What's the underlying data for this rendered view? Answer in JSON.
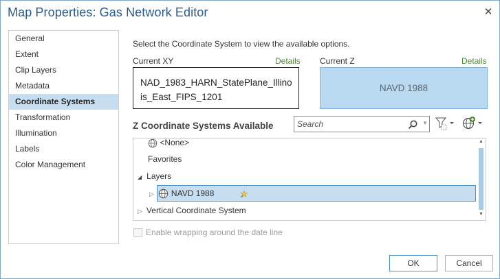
{
  "window": {
    "title": "Map Properties: Gas Network Editor",
    "close_glyph": "✕"
  },
  "sidebar": {
    "items": [
      {
        "label": "General",
        "selected": false
      },
      {
        "label": "Extent",
        "selected": false
      },
      {
        "label": "Clip Layers",
        "selected": false
      },
      {
        "label": "Metadata",
        "selected": false
      },
      {
        "label": "Coordinate Systems",
        "selected": true
      },
      {
        "label": "Transformation",
        "selected": false
      },
      {
        "label": "Illumination",
        "selected": false
      },
      {
        "label": "Labels",
        "selected": false
      },
      {
        "label": "Color Management",
        "selected": false
      }
    ]
  },
  "main": {
    "instruction": "Select the Coordinate System to view the available options.",
    "current_xy": {
      "label": "Current XY",
      "details": "Details",
      "value_line1": "NAD_1983_HARN_StatePlane_Illino",
      "value_line2": "is_East_FIPS_1201"
    },
    "current_z": {
      "label": "Current Z",
      "details": "Details",
      "value": "NAVD 1988"
    },
    "z_section": {
      "title": "Z Coordinate Systems Available",
      "search_placeholder": "Search"
    },
    "tree": {
      "none_item": "<None>",
      "favorites": "Favorites",
      "layers": "Layers",
      "layers_child": "NAVD 1988",
      "vertical": "Vertical Coordinate System"
    },
    "wrap_checkbox": {
      "label": "Enable wrapping around the date line",
      "checked": false,
      "enabled": false
    }
  },
  "footer": {
    "ok": "OK",
    "cancel": "Cancel"
  },
  "colors": {
    "title": "#2a5b8e",
    "selection": "#c7def0",
    "details_link": "#4b8b2f",
    "z_box": "#b8d9f0"
  }
}
